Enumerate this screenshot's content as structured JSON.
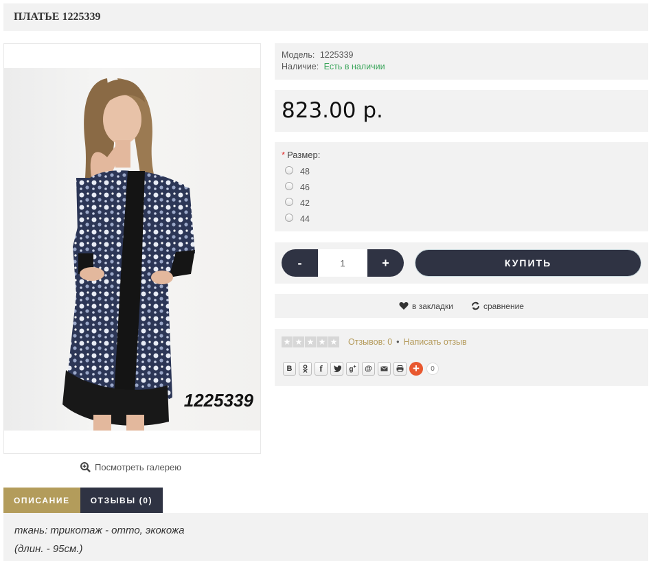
{
  "product": {
    "title": "ПЛАТЬЕ 1225339",
    "photo_code": "1225339",
    "gallery_link": "Посмотреть галерею"
  },
  "info": {
    "model_label": "Модель:",
    "model_value": "1225339",
    "stock_label": "Наличие:",
    "stock_value": "Есть в наличии"
  },
  "price": "823.00 р.",
  "options": {
    "required_mark": "*",
    "title": "Размер:",
    "sizes": [
      "48",
      "46",
      "42",
      "44"
    ]
  },
  "purchase": {
    "minus": "-",
    "quantity": "1",
    "plus": "+",
    "buy_label": "КУПИТЬ"
  },
  "actions": {
    "bookmarks": "в закладки",
    "compare": "сравнение"
  },
  "reviews": {
    "count_label": "Отзывов: 0",
    "separator": "•",
    "write_label": "Написать отзыв"
  },
  "share": {
    "buttons": [
      "В",
      "ok",
      "f",
      "tw",
      "g+",
      "@",
      "mail",
      "print"
    ],
    "count": "0"
  },
  "tabs": {
    "description": "ОПИСАНИЕ",
    "reviews": "ОТЗЫВЫ (0)"
  },
  "description": {
    "line1": "ткань: трикотаж - отто, экокожа",
    "line2": "(длин. - 95см.)"
  },
  "colors": {
    "accent": "#b39c5b",
    "dark": "#2f3343",
    "panel": "#f2f2f2",
    "in_stock": "#3aa55a",
    "share_plus": "#e8582f"
  }
}
